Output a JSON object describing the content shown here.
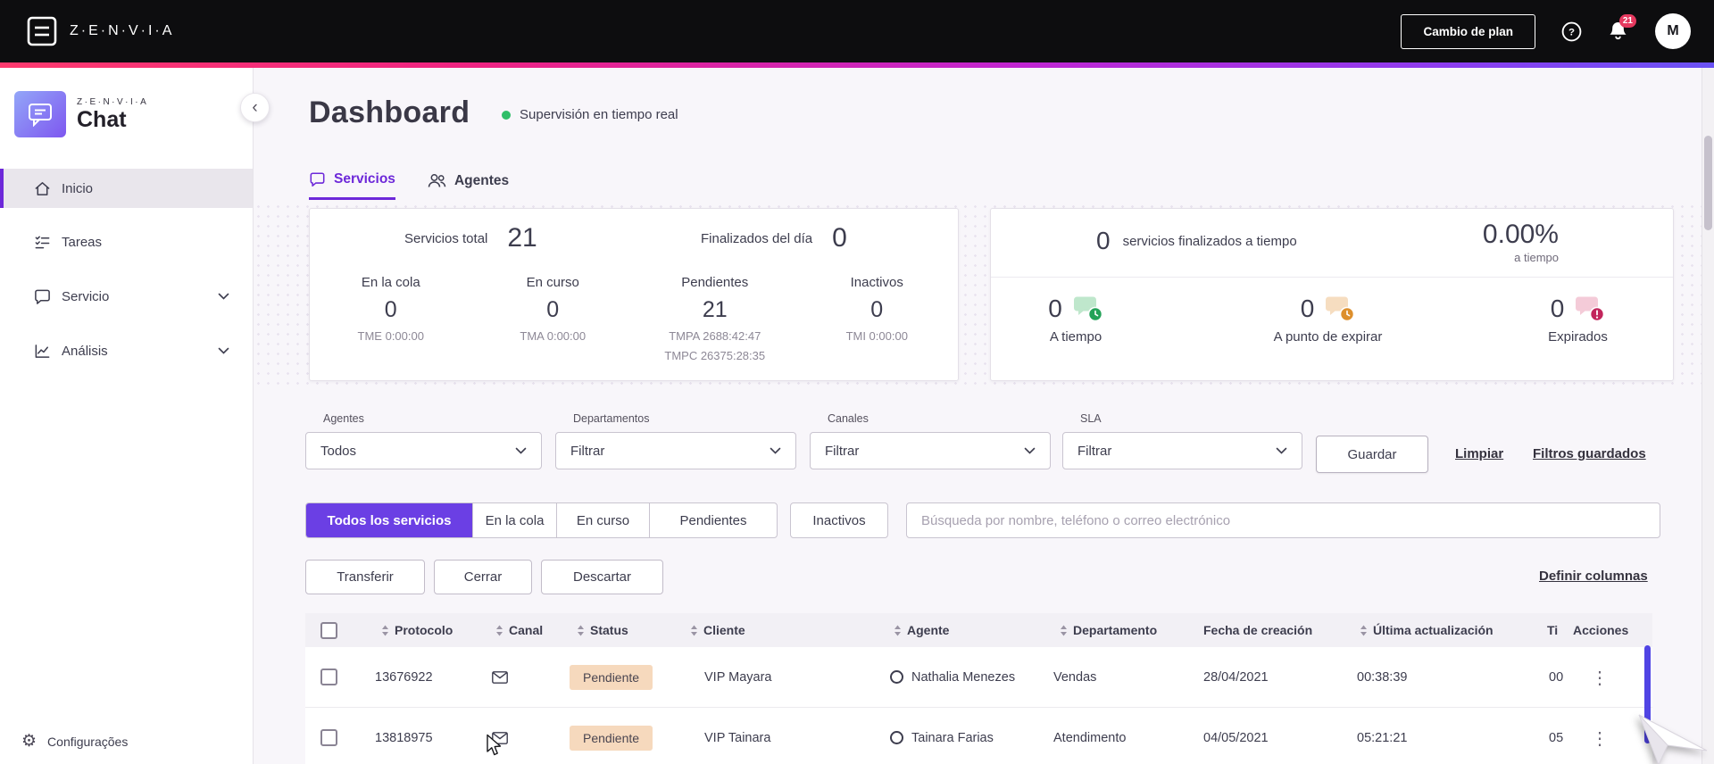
{
  "topbar": {
    "brand": "Z·E·N·V·I·A",
    "change_plan_label": "Cambio de plan",
    "notification_count": "21",
    "avatar_initial": "M"
  },
  "sidebar": {
    "brand": "Z·E·N·V·I·A",
    "product": "Chat",
    "items": [
      {
        "label": "Inicio"
      },
      {
        "label": "Tareas"
      },
      {
        "label": "Servicio"
      },
      {
        "label": "Análisis"
      }
    ],
    "footer_label": "Configurações"
  },
  "page": {
    "title": "Dashboard",
    "realtime_label": "Supervisión en tiempo real"
  },
  "tabs": [
    {
      "label": "Servicios"
    },
    {
      "label": "Agentes"
    }
  ],
  "summary_card": {
    "total_label": "Servicios total",
    "total_value": "21",
    "finished_label": "Finalizados del día",
    "finished_value": "0",
    "stats": [
      {
        "label": "En la cola",
        "value": "0",
        "metric1": "TME 0:00:00",
        "metric2": ""
      },
      {
        "label": "En curso",
        "value": "0",
        "metric1": "TMA 0:00:00",
        "metric2": ""
      },
      {
        "label": "Pendientes",
        "value": "21",
        "metric1": "TMPA 2688:42:47",
        "metric2": "TMPC 26375:28:35"
      },
      {
        "label": "Inactivos",
        "value": "0",
        "metric1": "TMI 0:00:00",
        "metric2": ""
      }
    ]
  },
  "sla_card": {
    "finished_value": "0",
    "finished_label": "servicios finalizados a tiempo",
    "percent_value": "0.00%",
    "percent_label": "a tiempo",
    "stats": [
      {
        "value": "0",
        "label": "A tiempo"
      },
      {
        "value": "0",
        "label": "A punto de expirar"
      },
      {
        "value": "0",
        "label": "Expirados"
      }
    ]
  },
  "filters": {
    "fields": [
      {
        "label": "Agentes",
        "value": "Todos"
      },
      {
        "label": "Departamentos",
        "value": "Filtrar"
      },
      {
        "label": "Canales",
        "value": "Filtrar"
      },
      {
        "label": "SLA",
        "value": "Filtrar"
      }
    ],
    "save_label": "Guardar",
    "clear_label": "Limpiar",
    "saved_label": "Filtros guardados"
  },
  "service_tabs": [
    {
      "label": "Todos los servicios"
    },
    {
      "label": "En la cola"
    },
    {
      "label": "En curso"
    },
    {
      "label": "Pendientes"
    },
    {
      "label": "Inactivos"
    }
  ],
  "search": {
    "placeholder": "Búsqueda por nombre, teléfono o correo electrónico"
  },
  "bulk_actions": {
    "transfer": "Transferir",
    "close": "Cerrar",
    "discard": "Descartar",
    "define_columns": "Definir columnas"
  },
  "table": {
    "columns": [
      {
        "label": "Protocolo"
      },
      {
        "label": "Canal"
      },
      {
        "label": "Status"
      },
      {
        "label": "Cliente"
      },
      {
        "label": "Agente"
      },
      {
        "label": "Departamento"
      },
      {
        "label": "Fecha de creación"
      },
      {
        "label": "Última actualización"
      },
      {
        "label": "Ti"
      },
      {
        "label": "Acciones"
      }
    ],
    "rows": [
      {
        "protocol": "13676922",
        "channel": "email",
        "status": "Pendiente",
        "client": "VIP Mayara",
        "agent": "Nathalia Menezes",
        "department": "Vendas",
        "created": "28/04/2021",
        "updated": "00:38:39",
        "time": "00"
      },
      {
        "protocol": "13818975",
        "channel": "email",
        "status": "Pendiente",
        "client": "VIP Tainara",
        "agent": "Tainara Farias",
        "department": "Atendimento",
        "created": "04/05/2021",
        "updated": "05:21:21",
        "time": "05"
      }
    ]
  },
  "icons": {
    "collapse_chevron": "‹",
    "gear": "⚙",
    "kebab": "⋮"
  },
  "colors": {
    "accent_purple": "#6d28d9",
    "active_filter_bg": "#6b3fe4",
    "gradient_left": "#ff3a6e",
    "gradient_right": "#6a52f5",
    "status_pending_bg": "#f6d9bd",
    "online_green": "#2fbe68",
    "sla_ontime_green": "#23a258",
    "sla_expiring_orange": "#dd8f2d",
    "sla_expired_red": "#c2255c",
    "notification_red": "#e5395f",
    "table_scrollbar": "#5044e4"
  }
}
